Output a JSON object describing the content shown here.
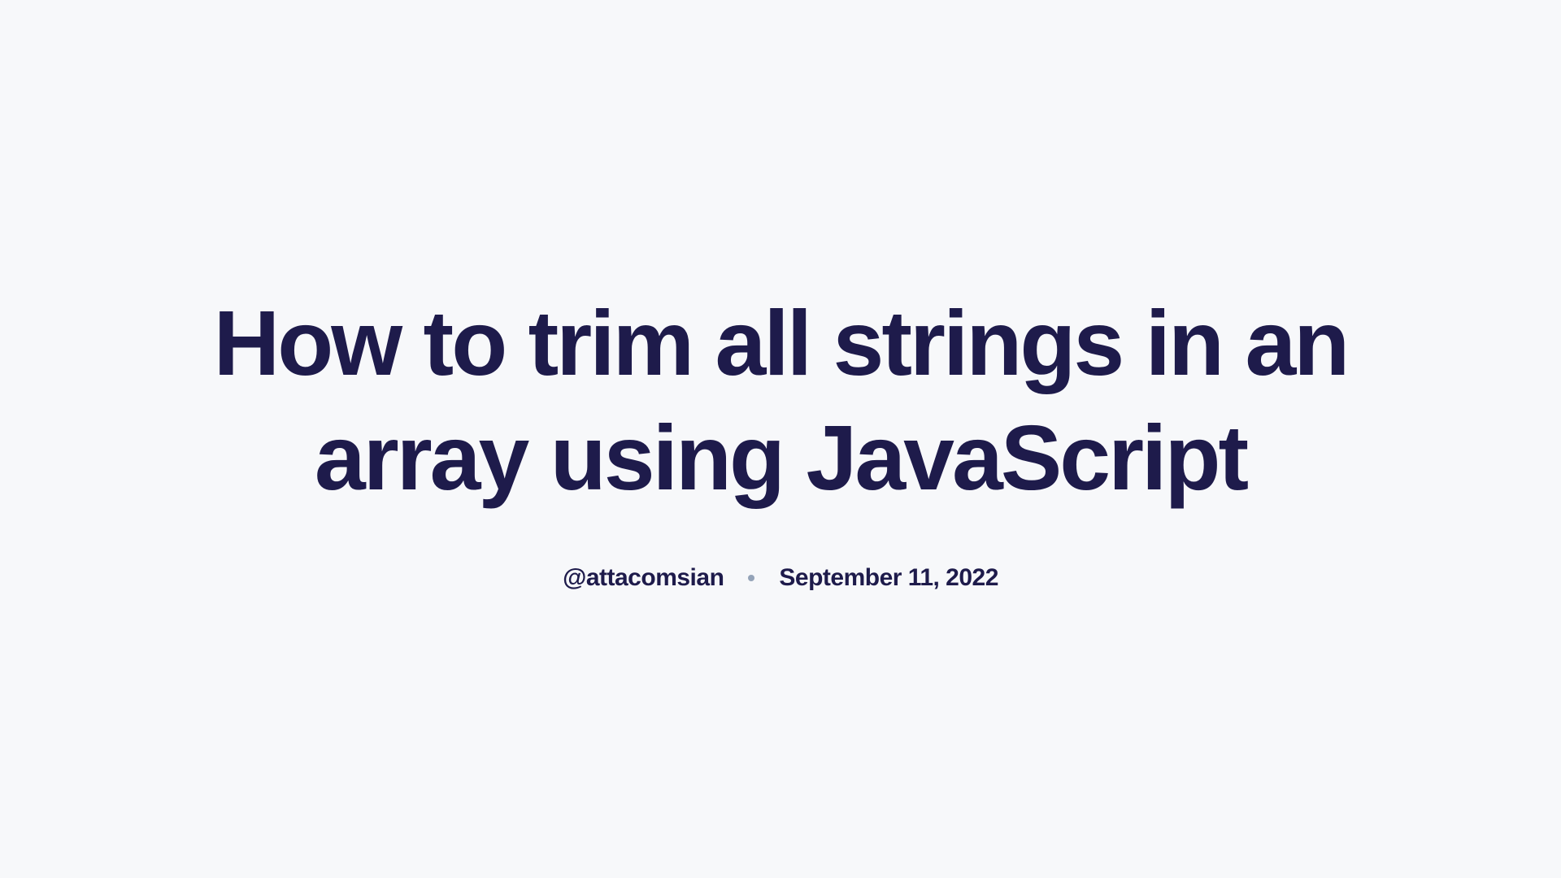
{
  "article": {
    "title": "How to trim all strings in an array using JavaScript",
    "author": "@attacomsian",
    "date": "September 11, 2022"
  }
}
